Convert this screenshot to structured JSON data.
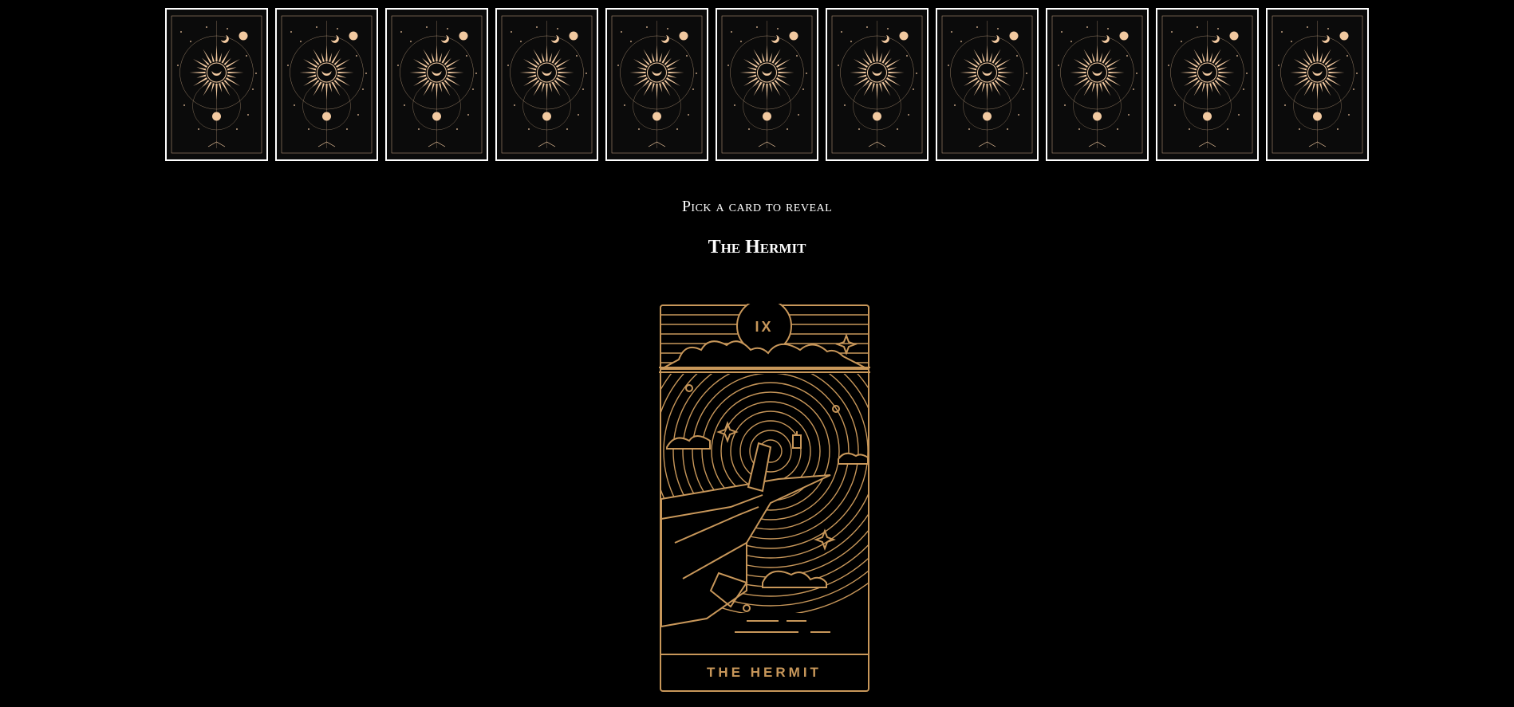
{
  "deck": {
    "card_count": 11,
    "card_back_icon": "sun-moon-card-back-icon",
    "accent_color": "#f2c9a0",
    "border_color": "#ffffff"
  },
  "prompt": "Pick a card to reveal",
  "revealed": {
    "name": "The Hermit",
    "numeral": "IX",
    "card_caption": "THE HERMIT",
    "art_color": "#c8975a",
    "icon": "hermit-card-art-icon"
  }
}
